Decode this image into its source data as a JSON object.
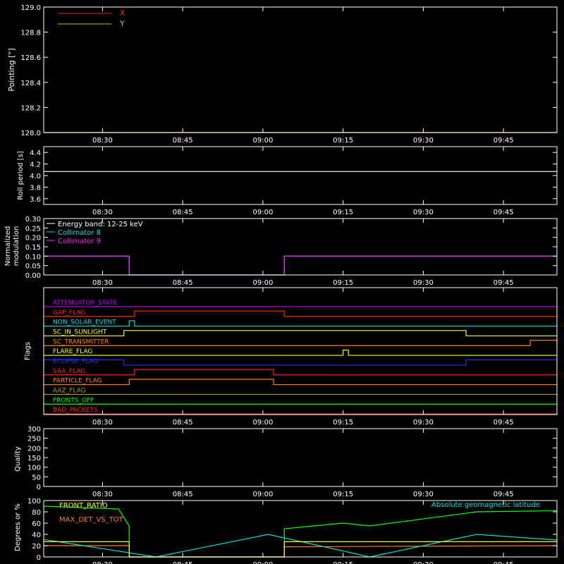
{
  "time_ticks": [
    "08:30",
    "08:45",
    "09:00",
    "09:15",
    "09:30",
    "09:45"
  ],
  "colors": {
    "background": "#000000",
    "axis": "#ffffff",
    "red": "#ff2020",
    "yellow": "#c8c800",
    "cyan": "#00e0e0",
    "magenta": "#ff20ff",
    "orange": "#ff8000",
    "green": "#00ff00",
    "blue": "#2030ff",
    "olive": "#a0a000",
    "violet": "#c000ff"
  },
  "chart_data": [
    {
      "id": "pointing",
      "type": "line",
      "ylabel": "Pointing [\"]",
      "ylim": [
        128.0,
        129.0
      ],
      "yticks": [
        "128.0",
        "128.2",
        "128.4",
        "128.6",
        "128.8",
        "129.0"
      ],
      "series": [
        {
          "name": "X",
          "color": "#ff2020",
          "x": [
            "08:19",
            "09:55"
          ],
          "values": [
            128.0,
            128.0
          ]
        },
        {
          "name": "Y",
          "color": "#c8c800",
          "x": [
            "08:19",
            "09:55"
          ],
          "values": [
            128.0,
            128.0
          ]
        }
      ]
    },
    {
      "id": "roll",
      "type": "line",
      "ylabel": "Roll period [s]",
      "ylim": [
        3.5,
        4.5
      ],
      "yticks": [
        "3.6",
        "3.8",
        "4.0",
        "4.2",
        "4.4"
      ],
      "series": [
        {
          "name": "",
          "color": "#ffffff",
          "x": [
            "08:19",
            "09:55"
          ],
          "values": [
            4.07,
            4.07
          ]
        }
      ]
    },
    {
      "id": "modulation",
      "type": "line",
      "ylabel": "Normalized modulation",
      "ylim": [
        0.0,
        0.3
      ],
      "yticks": [
        "0.00",
        "0.05",
        "0.10",
        "0.15",
        "0.20",
        "0.25",
        "0.30"
      ],
      "legend": [
        "Energy band: 12-25 keV",
        "Collimator 8",
        "Collimator 9"
      ],
      "series": [
        {
          "name": "Collimator 8",
          "color": "#00e0e0",
          "x": [
            "08:19",
            "08:35",
            "08:35",
            "09:04",
            "09:04",
            "09:55"
          ],
          "values": [
            0.1,
            0.1,
            0.0,
            0.0,
            0.1,
            0.1
          ]
        },
        {
          "name": "Collimator 9",
          "color": "#ff20ff",
          "x": [
            "08:19",
            "08:35",
            "08:35",
            "09:04",
            "09:04",
            "09:55"
          ],
          "values": [
            0.1,
            0.1,
            0.0,
            0.0,
            0.1,
            0.1
          ]
        }
      ]
    },
    {
      "id": "flags",
      "type": "line",
      "ylabel": "Flags",
      "flags": [
        {
          "name": "ATTENUATOR_STATE",
          "color": "#c000ff",
          "on": []
        },
        {
          "name": "GAP_FLAG",
          "color": "#ff2020",
          "on": [
            [
              "08:36",
              "09:04"
            ]
          ]
        },
        {
          "name": "NON_SOLAR_EVENT",
          "color": "#00e0e0",
          "on": [
            [
              "08:35",
              "08:36"
            ]
          ]
        },
        {
          "name": "SC_IN_SUNLIGHT",
          "color": "#ffff00",
          "on": [
            [
              "08:34",
              "09:38"
            ]
          ]
        },
        {
          "name": "SC_TRANSMITTER",
          "color": "#ff8000",
          "on": [
            [
              "09:50",
              "09:55"
            ]
          ]
        },
        {
          "name": "FLARE_FLAG",
          "color": "#ffff00",
          "on": [
            [
              "09:15",
              "09:16"
            ]
          ]
        },
        {
          "name": "ECLIPSE_FLAG",
          "color": "#2030ff",
          "on": [
            [
              "08:19",
              "08:34"
            ],
            [
              "09:38",
              "09:55"
            ]
          ]
        },
        {
          "name": "SAA_FLAG",
          "color": "#ff2020",
          "on": [
            [
              "08:36",
              "09:02"
            ]
          ]
        },
        {
          "name": "PARTICLE_FLAG",
          "color": "#ff8000",
          "on": [
            [
              "08:35",
              "09:02"
            ]
          ]
        },
        {
          "name": "AAZ_FLAG",
          "color": "#a0a000",
          "on": []
        },
        {
          "name": "FRONTS_OFF",
          "color": "#00ff00",
          "on": []
        },
        {
          "name": "BAD_PACKETS",
          "color": "#ff2020",
          "on": []
        }
      ]
    },
    {
      "id": "quality",
      "type": "line",
      "ylabel": "Quality",
      "ylim": [
        0,
        300
      ],
      "yticks": [
        "0",
        "50",
        "100",
        "150",
        "200",
        "250",
        "300"
      ],
      "series": []
    },
    {
      "id": "bottom",
      "type": "line",
      "ylabel": "Degrees or %",
      "ylim": [
        0,
        100
      ],
      "yticks": [
        "0",
        "20",
        "40",
        "60",
        "80",
        "100"
      ],
      "legend": [
        "FRONT_RATIO",
        "MAX_DET_VS_TOT"
      ],
      "annotation": "Absolute geomagnetic latitude",
      "series": [
        {
          "name": "FRONT_RATIO",
          "color": "#00ff00",
          "x": [
            "08:19",
            "08:33",
            "08:35",
            "08:35",
            "09:04",
            "09:04",
            "09:15",
            "09:20",
            "09:40",
            "09:55"
          ],
          "values": [
            90,
            85,
            55,
            0,
            0,
            50,
            60,
            55,
            80,
            82
          ]
        },
        {
          "name": "MAX_DET_VS_TOT",
          "color": "#ff8000",
          "x": [
            "08:19",
            "08:35",
            "08:35",
            "09:04",
            "09:04",
            "09:55"
          ],
          "values": [
            20,
            20,
            0,
            0,
            18,
            20
          ]
        },
        {
          "name": "Absolute geomagnetic latitude",
          "color": "#00e0e0",
          "x": [
            "08:19",
            "08:40",
            "09:01",
            "09:20",
            "09:40",
            "09:55"
          ],
          "values": [
            31,
            0,
            40,
            0,
            40,
            30
          ]
        },
        {
          "name": "",
          "color": "#ffff00",
          "x": [
            "08:19",
            "08:35",
            "08:35",
            "09:04",
            "09:04",
            "09:55"
          ],
          "values": [
            27,
            27,
            0,
            0,
            27,
            27
          ]
        }
      ]
    }
  ]
}
